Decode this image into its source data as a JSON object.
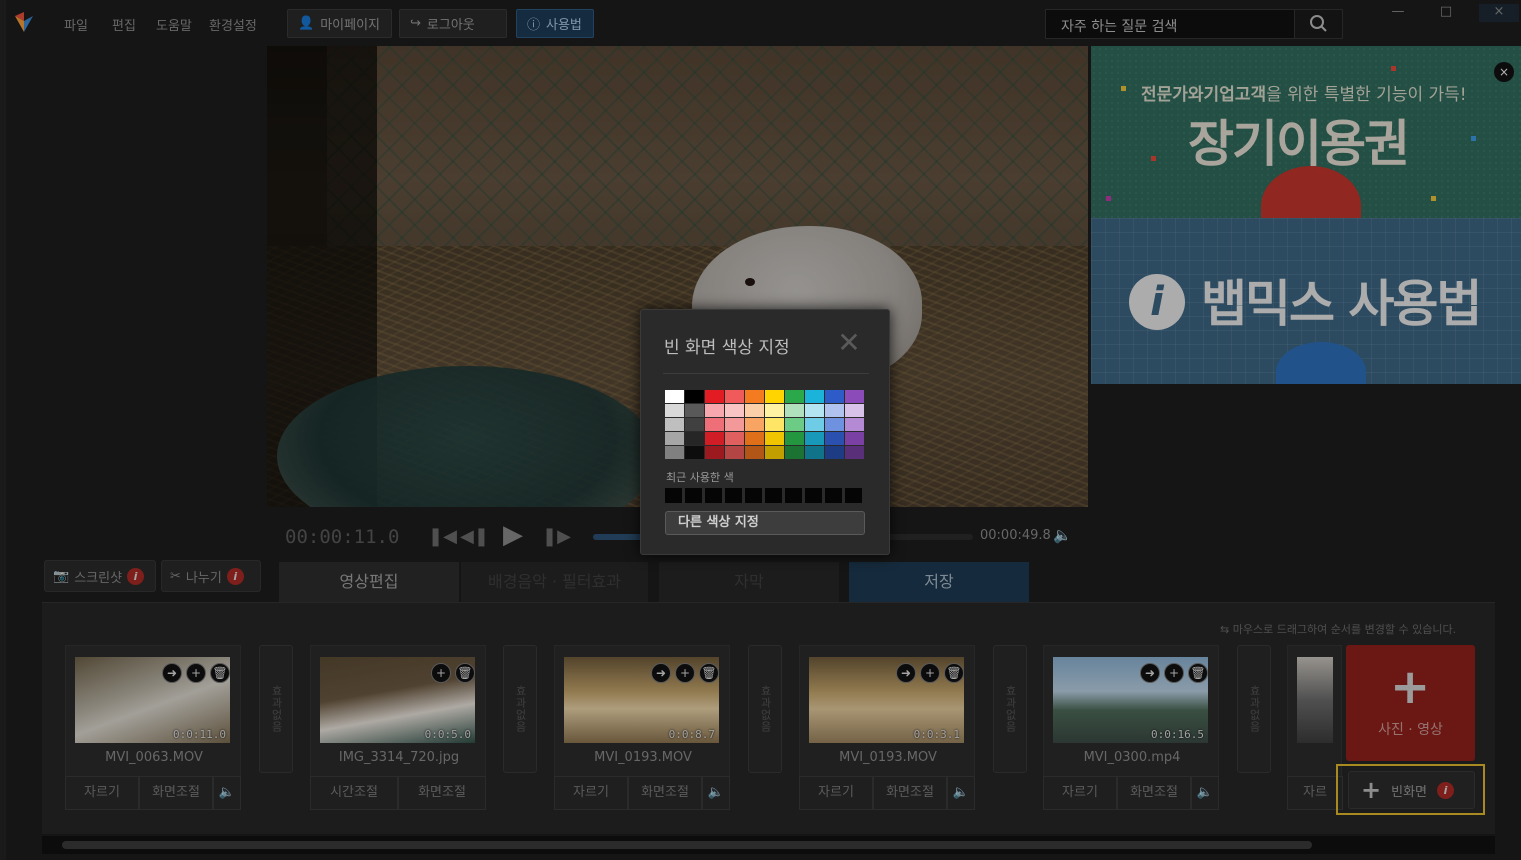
{
  "menu": {
    "file": "파일",
    "edit": "편집",
    "help": "도움말",
    "settings": "환경설정"
  },
  "topbar": {
    "mypage": "마이페이지",
    "logout": "로그아웃",
    "howto": "사용법"
  },
  "faq": {
    "placeholder": "자주 하는 질문 검색"
  },
  "window": {
    "minimize": "—",
    "maximize": "□",
    "close": "×"
  },
  "ad": {
    "subtitle_bold": "전문가와기업고객",
    "subtitle_rest": "을 위한 특별한 기능이 가득!",
    "title": "장기이용권",
    "howto": "뱁믹스 사용법",
    "info_glyph": "i",
    "close": "×"
  },
  "player": {
    "current_time": "00:00:11.0",
    "total_time": "00:00:49.8",
    "progress_fraction": 0.14
  },
  "tools": {
    "screenshot": "스크린샷",
    "split": "나누기"
  },
  "tabs": [
    "영상편집",
    "배경음악 · 필터효과",
    "자막",
    "저장"
  ],
  "timeline": {
    "hint": "마우스로 드래그하여 순서를 변경할 수 있습니다.",
    "effect_label": "효과없음",
    "clips": [
      {
        "name": "MVI_0063.MOV",
        "duration": "0:0:11.0",
        "actions": [
          "자르기",
          "화면조절"
        ],
        "has_volume": true
      },
      {
        "name": "IMG_3314_720.jpg",
        "duration": "0:0:5.0",
        "actions": [
          "시간조절",
          "화면조절"
        ],
        "has_volume": false
      },
      {
        "name": "MVI_0193.MOV",
        "duration": "0:0:8.7",
        "actions": [
          "자르기",
          "화면조절"
        ],
        "has_volume": true
      },
      {
        "name": "MVI_0193.MOV",
        "duration": "0:0:3.1",
        "actions": [
          "자르기",
          "화면조절"
        ],
        "has_volume": true
      },
      {
        "name": "MVI_0300.mp4",
        "duration": "0:0:16.5",
        "actions": [
          "자르기",
          "화면조절"
        ],
        "has_volume": true
      }
    ],
    "partial_clip_action": "자르",
    "add_media": "사진 · 영상",
    "blank_screen": "빈화면"
  },
  "dialog": {
    "title": "빈 화면 색상 지정",
    "recent_label": "최근 사용한 색",
    "other_color": "다른 색상 지정",
    "palette": [
      [
        "#ffffff",
        "#d9d9d9",
        "#bfbfbf",
        "#a6a6a6",
        "#808080"
      ],
      [
        "#000000",
        "#595959",
        "#404040",
        "#262626",
        "#0d0d0d"
      ],
      [
        "#e31b23",
        "#f6a8ae",
        "#ef6f78",
        "#d11d26",
        "#9c1a1f"
      ],
      [
        "#f05a5a",
        "#f8c4c4",
        "#f49999",
        "#e06060",
        "#b34545"
      ],
      [
        "#f47b20",
        "#fbd0a8",
        "#f8a563",
        "#e06f1a",
        "#b15616"
      ],
      [
        "#ffd400",
        "#fff3a3",
        "#ffe566",
        "#f0c400",
        "#c29e00"
      ],
      [
        "#2aa84a",
        "#b1e0bd",
        "#6ccb85",
        "#259640",
        "#1c7232"
      ],
      [
        "#1bb3d9",
        "#b2e4f1",
        "#6fcce6",
        "#1899ba",
        "#117389"
      ],
      [
        "#2d5cc8",
        "#b0c3ef",
        "#6f92e0",
        "#2a51b0",
        "#1e3c84"
      ],
      [
        "#8b4bb8",
        "#d9c2e9",
        "#b48ad4",
        "#7a40a3",
        "#5a2f79"
      ]
    ],
    "recent_count": 10
  }
}
